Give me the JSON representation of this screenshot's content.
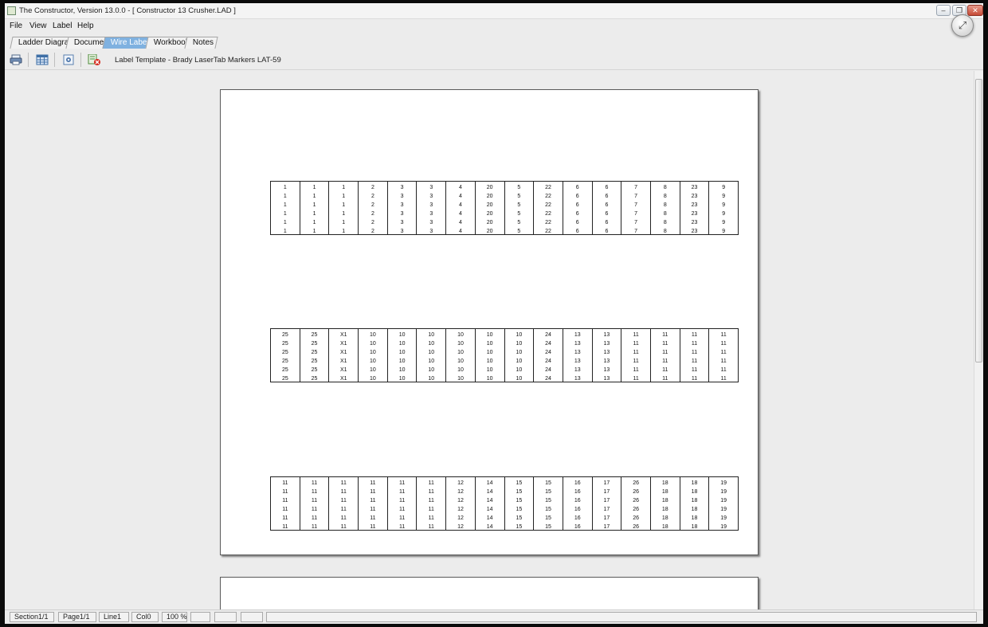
{
  "window": {
    "title": "The Constructor, Version 13.0.0  -  [ Constructor 13 Crusher.LAD ]",
    "controls": {
      "minimize": "–",
      "restore": "❐",
      "close": "✕"
    },
    "expand_icon": "expand-arrows-icon",
    "expand_glyph": "⤢"
  },
  "menubar": {
    "items": [
      "File",
      "View",
      "Label",
      "Help"
    ]
  },
  "tabs": [
    "Ladder Diagram",
    "Document",
    "Wire Labels",
    "Workbook",
    "Notes"
  ],
  "active_tab": "Wire Labels",
  "toolbar": {
    "icons": [
      "print-icon",
      "table-grid-icon",
      "settings-icon",
      "delete-spreadsheet-icon"
    ],
    "template_label": "Label Template - Brady LaserTab Markers LAT-59"
  },
  "labels": {
    "rows_per_cell": 6,
    "strips": [
      [
        "1",
        "1",
        "1",
        "2",
        "3",
        "3",
        "4",
        "20",
        "5",
        "22",
        "6",
        "6",
        "7",
        "8",
        "23",
        "9"
      ],
      [
        "25",
        "25",
        "X1",
        "10",
        "10",
        "10",
        "10",
        "10",
        "10",
        "24",
        "13",
        "13",
        "11",
        "11",
        "11",
        "11"
      ],
      [
        "11",
        "11",
        "11",
        "11",
        "11",
        "11",
        "12",
        "14",
        "15",
        "15",
        "16",
        "17",
        "26",
        "18",
        "18",
        "19"
      ]
    ]
  },
  "status": [
    "Section1/1",
    "Page1/1",
    "Line1",
    "Col0",
    "100 %",
    "",
    "",
    ""
  ]
}
